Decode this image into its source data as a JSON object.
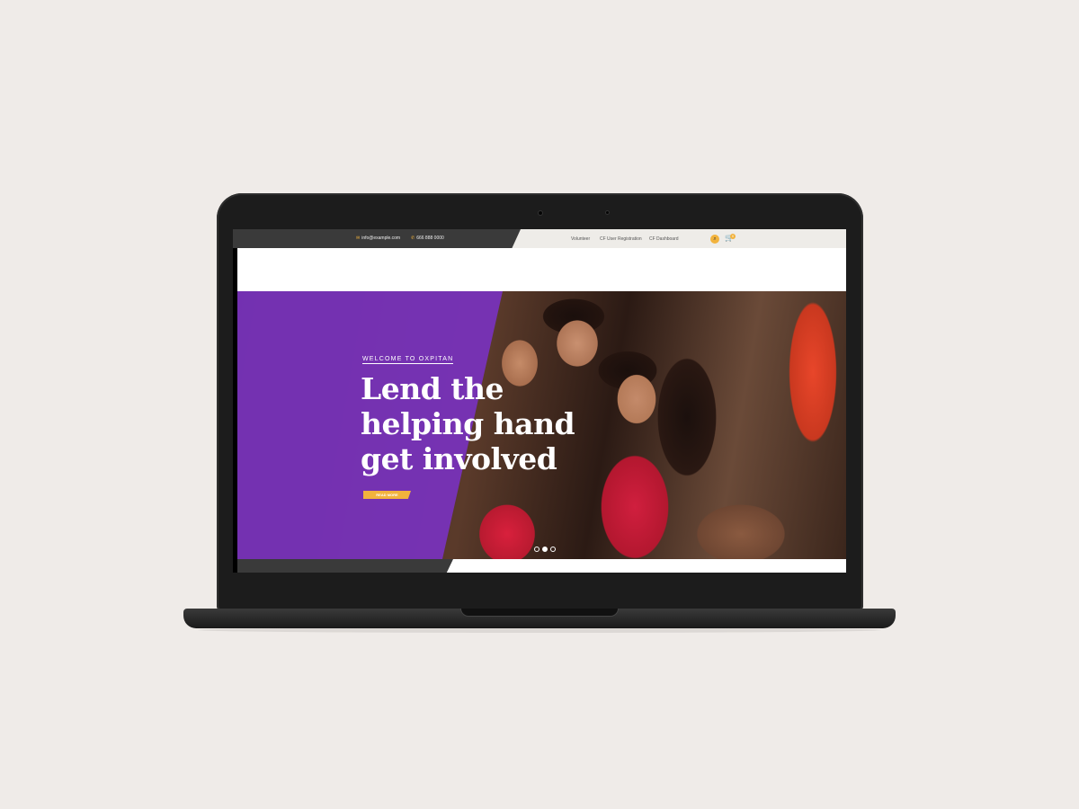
{
  "topbar": {
    "email": "info@example.com",
    "phone": "666 888 0000",
    "email_icon": "envelope-icon",
    "phone_icon": "phone-icon",
    "nav": [
      "Volunteer",
      "CF User Registration",
      "CF Dashboard"
    ],
    "cart_count": "0"
  },
  "hero": {
    "kicker": "WELCOME TO OXPITAN",
    "headline": [
      "Lend the",
      "helping hand",
      "get involved"
    ],
    "button": "READ MORE",
    "slides_total": 3,
    "slide_active": 2
  },
  "colors": {
    "accent": "#f2b33d",
    "overlay": "#7832be",
    "topbar_dark": "#3a3a3a"
  }
}
